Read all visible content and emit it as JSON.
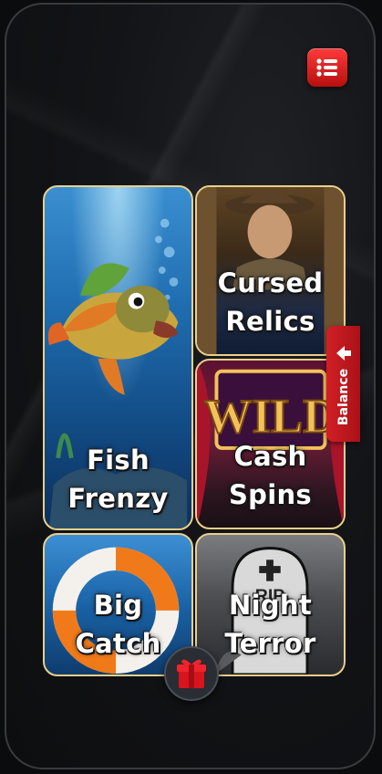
{
  "menu": {
    "icon": "menu-list-icon",
    "color": "#e02020"
  },
  "games": [
    {
      "id": "fish-frenzy",
      "line1": "Fish",
      "line2": "Frenzy"
    },
    {
      "id": "cursed-relics",
      "line1": "Cursed",
      "line2": "Relics"
    },
    {
      "id": "cash-spins",
      "line1": "Cash",
      "line2": "Spins",
      "art_text": "WILD"
    },
    {
      "id": "big-catch",
      "line1": "Big",
      "line2": "Catch"
    },
    {
      "id": "night-terror",
      "line1": "Night",
      "line2": "Terror",
      "art_text": "RIP"
    }
  ],
  "balance_tab": {
    "label": "Balance",
    "icon": "arrow-left-icon"
  },
  "gift": {
    "icon": "gift-icon"
  },
  "colors": {
    "accent_red": "#d21f25",
    "card_border": "#e9cf8c",
    "background": "#0b0c0e"
  }
}
